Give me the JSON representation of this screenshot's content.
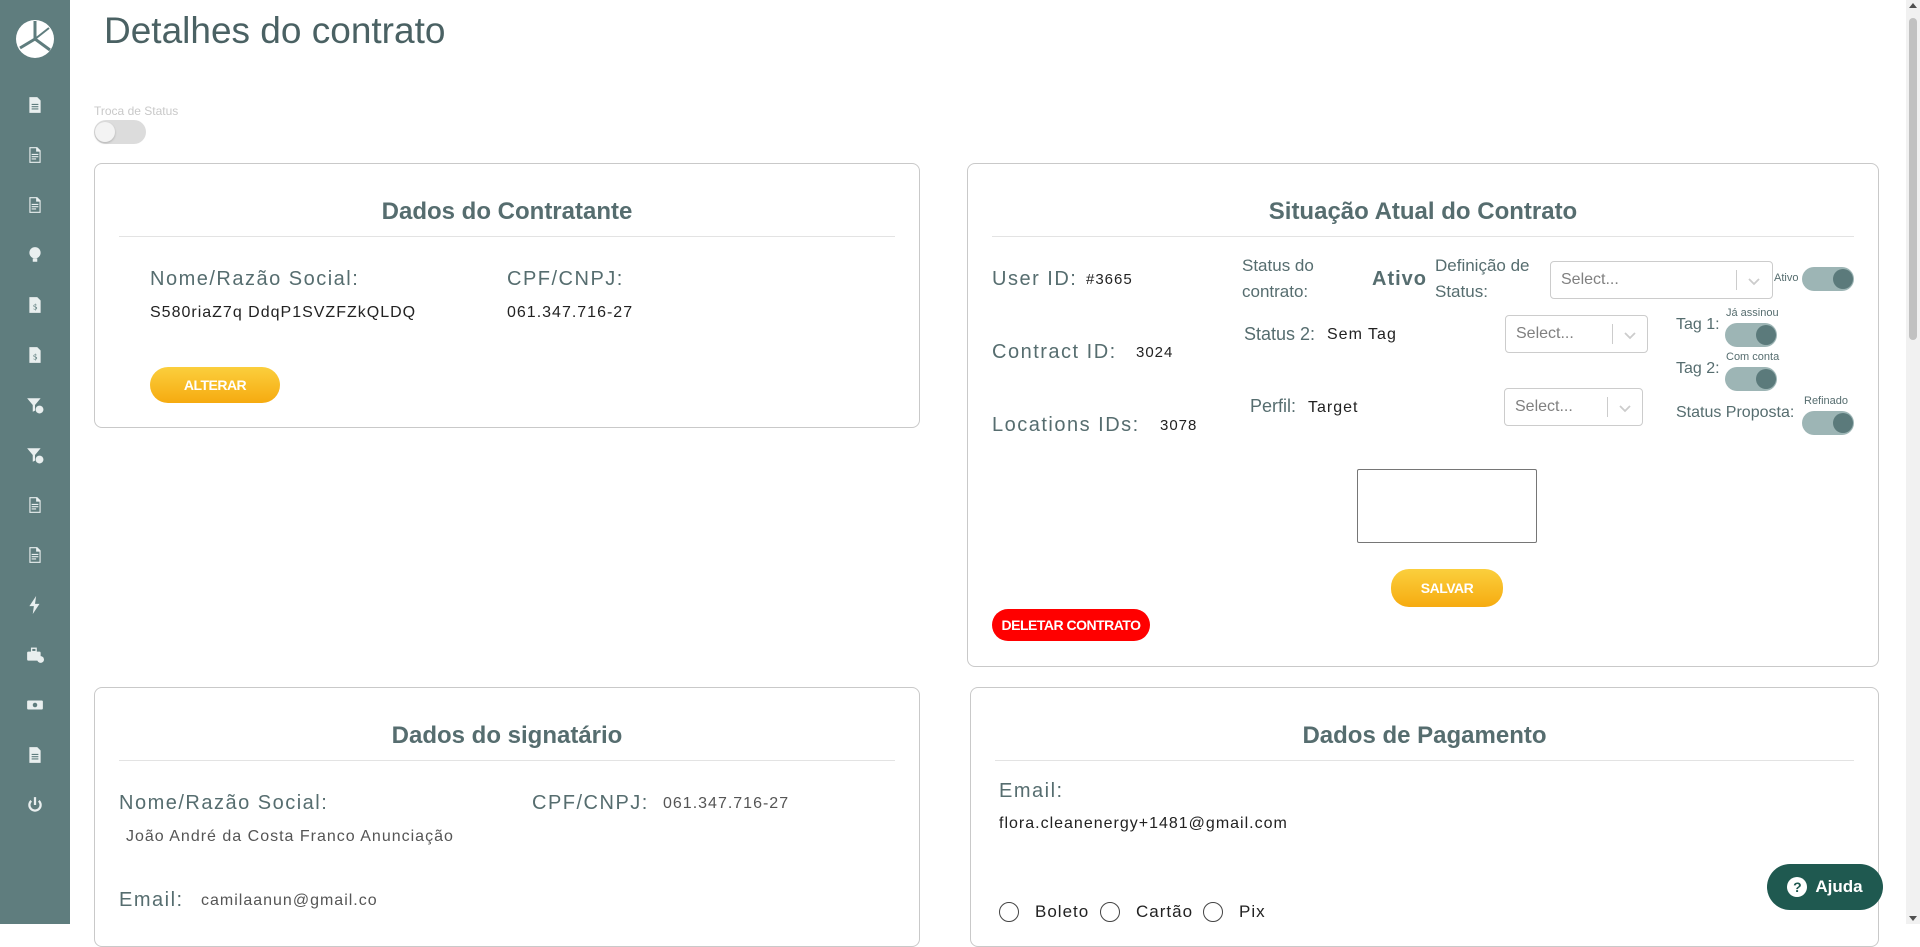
{
  "page": {
    "title": "Detalhes do contrato"
  },
  "sidebar": {
    "items": [
      {
        "icon": "file-icon"
      },
      {
        "icon": "document-icon"
      },
      {
        "icon": "document-icon"
      },
      {
        "icon": "lightbulb-icon"
      },
      {
        "icon": "invoice-icon"
      },
      {
        "icon": "invoice-icon"
      },
      {
        "icon": "filter-dollar-icon"
      },
      {
        "icon": "filter-dollar-icon"
      },
      {
        "icon": "document-icon"
      },
      {
        "icon": "document-icon"
      },
      {
        "icon": "lightning-icon"
      },
      {
        "icon": "toolbox-icon"
      },
      {
        "icon": "money-icon"
      },
      {
        "icon": "file-icon"
      },
      {
        "icon": "power-icon"
      }
    ]
  },
  "status_toggle": {
    "label": "Troca de Status",
    "on": false
  },
  "contratante": {
    "title": "Dados do Contratante",
    "name_label": "Nome/Razão Social:",
    "name_value": "S580riaZ7q DdqP1SVZFZkQLDQ",
    "cpf_label": "CPF/CNPJ:",
    "cpf_value": "061.347.716-27",
    "alterar_label": "ALTERAR"
  },
  "situacao": {
    "title": "Situação Atual do Contrato",
    "user_id_label": "User ID:",
    "user_id_value": "#3665",
    "contract_id_label": "Contract ID:",
    "contract_id_value": "3024",
    "locations_label": "Locations IDs:",
    "locations_value": "3078",
    "status_contrato_label_1": "Status do",
    "status_contrato_label_2": "contrato:",
    "status_contrato_value": "Ativo",
    "definicao_label_1": "Definição de",
    "definicao_label_2": "Status:",
    "definicao_placeholder": "Select...",
    "ativo_toggle_label": "Ativo",
    "status2_label": "Status 2:",
    "status2_value": "Sem Tag",
    "status2_placeholder": "Select...",
    "perfil_label": "Perfil:",
    "perfil_value": "Target",
    "perfil_placeholder": "Select...",
    "tag1_label": "Tag 1:",
    "tag1_toggle_label": "Já assinou",
    "tag2_label": "Tag 2:",
    "tag2_toggle_label": "Com conta",
    "status_proposta_label": "Status Proposta:",
    "status_proposta_toggle_label": "Refinado",
    "salvar_label": "SALVAR",
    "deletar_label": "DELETAR CONTRATO"
  },
  "signatario": {
    "title": "Dados do signatário",
    "name_label": "Nome/Razão Social:",
    "name_value": "João André da Costa Franco Anunciação",
    "cpf_label": "CPF/CNPJ:",
    "cpf_value": "061.347.716-27",
    "email_label": "Email:",
    "email_value": "camilaanun@gmail.co"
  },
  "pagamento": {
    "title": "Dados de Pagamento",
    "email_label": "Email:",
    "email_value": "flora.cleanenergy+1481@gmail.com",
    "options": [
      "Boleto",
      "Cartão",
      "Pix"
    ]
  },
  "help": {
    "label": "Ajuda"
  },
  "colors": {
    "sidebar": "#5f7d7e",
    "accent_yellow": "#f8bb22",
    "danger": "#ff0000",
    "help": "#1f5950"
  }
}
